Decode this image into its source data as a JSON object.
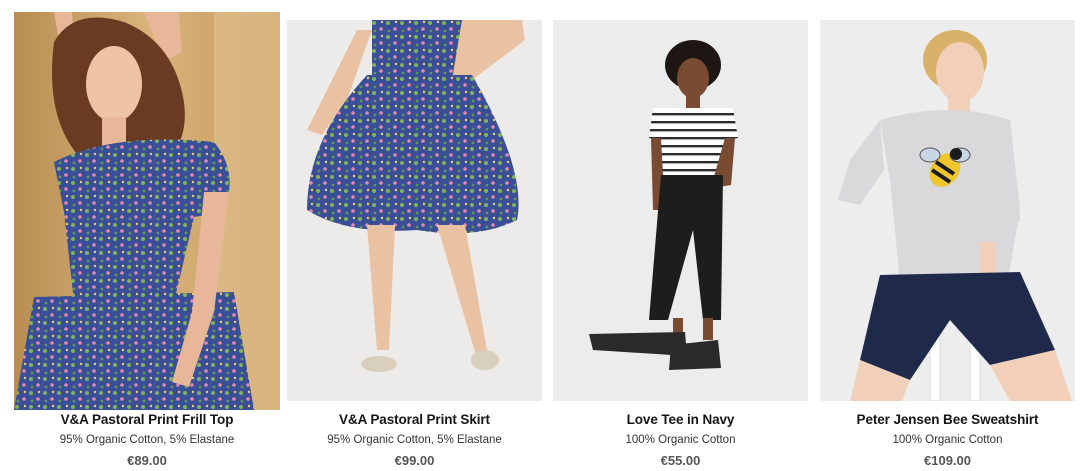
{
  "products": [
    {
      "title": "V&A Pastoral Print Frill Top",
      "description": "95% Organic Cotton, 5% Elastane",
      "price": "€89.00",
      "image": "woman-in-floral-frill-top-photo",
      "colors": {
        "background": "#caa065",
        "garment": "#3b4f98",
        "accent": "#7fb45b"
      }
    },
    {
      "title": "V&A Pastoral Print Skirt",
      "description": "95% Organic Cotton, 5% Elastane",
      "price": "€99.00",
      "image": "woman-in-floral-skirt-photo",
      "colors": {
        "background": "#ecebea",
        "garment": "#3b4f98",
        "accent": "#7fb45b"
      }
    },
    {
      "title": "Love Tee in Navy",
      "description": "100% Organic Cotton",
      "price": "€55.00",
      "image": "woman-in-striped-tee-photo",
      "colors": {
        "background": "#ececec",
        "garment": "#ffffff",
        "accent": "#2c2c2c"
      }
    },
    {
      "title": "Peter Jensen Bee Sweatshirt",
      "description": "100% Organic Cotton",
      "price": "€109.00",
      "image": "woman-in-bee-sweatshirt-photo",
      "colors": {
        "background": "#ededed",
        "garment": "#d9d9dc",
        "accent": "#1f2a4a"
      }
    }
  ]
}
